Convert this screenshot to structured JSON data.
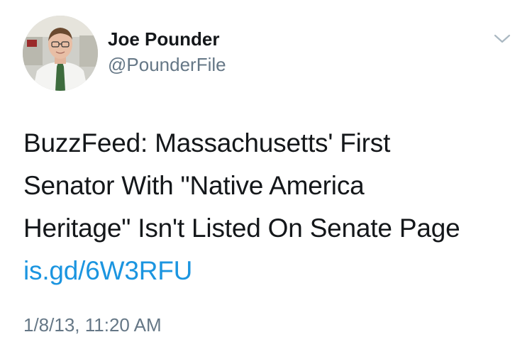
{
  "author": {
    "display_name": "Joe Pounder",
    "handle": "@PounderFile"
  },
  "tweet": {
    "text_lines": [
      "BuzzFeed: Massachusetts' First",
      "Senator With \"Native America",
      "Heritage\" Isn't Listed On Senate Page"
    ],
    "link": "is.gd/6W3RFU",
    "timestamp": "1/8/13, 11:20 AM"
  },
  "icons": {
    "menu": "chevron-down-icon",
    "avatar": "profile-photo"
  },
  "colors": {
    "text": "#14171a",
    "secondary": "#657786",
    "link": "#1b95e0",
    "background": "#ffffff"
  }
}
